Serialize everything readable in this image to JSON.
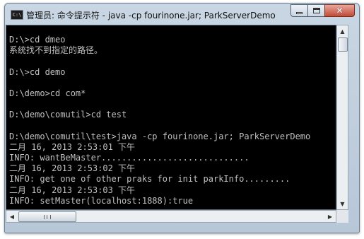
{
  "window": {
    "title": "管理员: 命令提示符 - java  -cp fourinone.jar; ParkServerDemo",
    "app_icon_text": "C:\\",
    "buttons": {
      "minimize": "minimize-icon",
      "maximize": "maximize-icon",
      "close": "close-icon"
    }
  },
  "console": {
    "lines": [
      "D:\\>cd dmeo",
      "系统找不到指定的路径。",
      "",
      "D:\\>cd demo",
      "",
      "D:\\demo>cd com*",
      "",
      "D:\\demo\\comutil>cd test",
      "",
      "D:\\demo\\comutil\\test>java -cp fourinone.jar; ParkServerDemo",
      "二月 16, 2013 2:53:01 下午",
      "INFO: wantBeMaster.............................",
      "二月 16, 2013 2:53:02 下午",
      "INFO: get one of other praks for init parkInfo.........",
      "二月 16, 2013 2:53:03 下午",
      "INFO: setMaster(localhost:1888):true"
    ]
  },
  "colors": {
    "console_bg": "#000000",
    "console_text": "#c0c0c0",
    "frame": "#b7c7d8"
  }
}
